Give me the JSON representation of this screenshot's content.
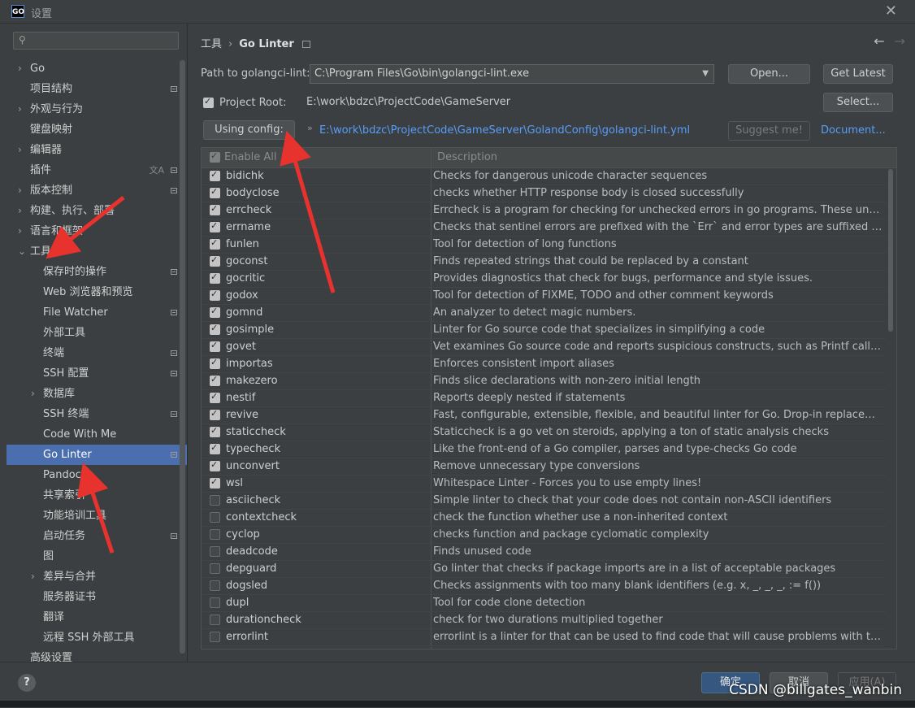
{
  "window": {
    "title": "设置",
    "app_icon_text": "GO"
  },
  "search": {
    "placeholder": ""
  },
  "sidebar": {
    "items": [
      {
        "label": "Go",
        "level": 0,
        "chevron": "›",
        "badge": false
      },
      {
        "label": "项目结构",
        "level": 0,
        "chevron": "",
        "badge": true
      },
      {
        "label": "外观与行为",
        "level": 0,
        "chevron": "›",
        "badge": false
      },
      {
        "label": "键盘映射",
        "level": 0,
        "chevron": "",
        "badge": false
      },
      {
        "label": "编辑器",
        "level": 0,
        "chevron": "›",
        "badge": false
      },
      {
        "label": "插件",
        "level": 0,
        "chevron": "",
        "badge": true,
        "translate": true
      },
      {
        "label": "版本控制",
        "level": 0,
        "chevron": "›",
        "badge": true
      },
      {
        "label": "构建、执行、部署",
        "level": 0,
        "chevron": "›",
        "badge": false
      },
      {
        "label": "语言和框架",
        "level": 0,
        "chevron": "›",
        "badge": false
      },
      {
        "label": "工具",
        "level": 0,
        "chevron": "⌄",
        "badge": false
      },
      {
        "label": "保存时的操作",
        "level": 1,
        "chevron": "",
        "badge": true
      },
      {
        "label": "Web 浏览器和预览",
        "level": 1,
        "chevron": "",
        "badge": false
      },
      {
        "label": "File Watcher",
        "level": 1,
        "chevron": "",
        "badge": true
      },
      {
        "label": "外部工具",
        "level": 1,
        "chevron": "",
        "badge": false
      },
      {
        "label": "终端",
        "level": 1,
        "chevron": "",
        "badge": true
      },
      {
        "label": "SSH 配置",
        "level": 1,
        "chevron": "",
        "badge": true
      },
      {
        "label": "数据库",
        "level": 1,
        "chevron": "›",
        "badge": false
      },
      {
        "label": "SSH 终端",
        "level": 1,
        "chevron": "",
        "badge": true
      },
      {
        "label": "Code With Me",
        "level": 1,
        "chevron": "",
        "badge": false
      },
      {
        "label": "Go Linter",
        "level": 1,
        "chevron": "",
        "badge": true,
        "selected": true
      },
      {
        "label": "Pandoc",
        "level": 1,
        "chevron": "",
        "badge": false
      },
      {
        "label": "共享索引",
        "level": 1,
        "chevron": "",
        "badge": false
      },
      {
        "label": "功能培训工具",
        "level": 1,
        "chevron": "",
        "badge": false
      },
      {
        "label": "启动任务",
        "level": 1,
        "chevron": "",
        "badge": true
      },
      {
        "label": "图",
        "level": 1,
        "chevron": "",
        "badge": false
      },
      {
        "label": "差异与合并",
        "level": 1,
        "chevron": "›",
        "badge": false
      },
      {
        "label": "服务器证书",
        "level": 1,
        "chevron": "",
        "badge": false
      },
      {
        "label": "翻译",
        "level": 1,
        "chevron": "",
        "badge": false
      },
      {
        "label": "远程 SSH 外部工具",
        "level": 1,
        "chevron": "",
        "badge": false
      },
      {
        "label": "高级设置",
        "level": 0,
        "chevron": "",
        "badge": false
      }
    ]
  },
  "breadcrumb": {
    "parent": "工具",
    "separator": "›",
    "current": "Go Linter"
  },
  "form": {
    "path_label": "Path to golangci-lint:",
    "path_value": "C:\\Program Files\\Go\\bin\\golangci-lint.exe",
    "open_button": "Open...",
    "get_latest_button": "Get Latest",
    "project_root_label": "Project Root:",
    "project_root_checked": true,
    "project_root_value": "E:\\work\\bdzc\\ProjectCode\\GameServer",
    "select_button": "Select...",
    "using_config_button": "Using config:",
    "config_arrow": "»",
    "config_path": "E:\\work\\bdzc\\ProjectCode\\GameServer\\GolandConfig\\golangci-lint.yml",
    "suggest_button": "Suggest me!",
    "document_link": "Document..."
  },
  "table": {
    "col_enable": "Enable All",
    "col_description": "Description",
    "rows": [
      {
        "name": "bidichk",
        "enabled": true,
        "desc": "Checks for dangerous unicode character sequences"
      },
      {
        "name": "bodyclose",
        "enabled": true,
        "desc": "checks whether HTTP response body is closed successfully"
      },
      {
        "name": "errcheck",
        "enabled": true,
        "desc": "Errcheck is a program for checking for unchecked errors in go programs. These unchecked errors"
      },
      {
        "name": "errname",
        "enabled": true,
        "desc": "Checks that sentinel errors are prefixed with the `Err` and error types are suffixed with the `Error`"
      },
      {
        "name": "funlen",
        "enabled": true,
        "desc": "Tool for detection of long functions"
      },
      {
        "name": "goconst",
        "enabled": true,
        "desc": "Finds repeated strings that could be replaced by a constant"
      },
      {
        "name": "gocritic",
        "enabled": true,
        "desc": "Provides diagnostics that check for bugs, performance and style issues."
      },
      {
        "name": "godox",
        "enabled": true,
        "desc": "Tool for detection of FIXME, TODO and other comment keywords"
      },
      {
        "name": "gomnd",
        "enabled": true,
        "desc": "An analyzer to detect magic numbers."
      },
      {
        "name": "gosimple",
        "enabled": true,
        "desc": "Linter for Go source code that specializes in simplifying a code"
      },
      {
        "name": "govet",
        "enabled": true,
        "desc": "Vet examines Go source code and reports suspicious constructs, such as Printf calls whose arguments"
      },
      {
        "name": "importas",
        "enabled": true,
        "desc": "Enforces consistent import aliases"
      },
      {
        "name": "makezero",
        "enabled": true,
        "desc": "Finds slice declarations with non-zero initial length"
      },
      {
        "name": "nestif",
        "enabled": true,
        "desc": "Reports deeply nested if statements"
      },
      {
        "name": "revive",
        "enabled": true,
        "desc": "Fast, configurable, extensible, flexible, and beautiful linter for Go. Drop-in replacement of golint."
      },
      {
        "name": "staticcheck",
        "enabled": true,
        "desc": "Staticcheck is a go vet on steroids, applying a ton of static analysis checks"
      },
      {
        "name": "typecheck",
        "enabled": true,
        "desc": "Like the front-end of a Go compiler, parses and type-checks Go code"
      },
      {
        "name": "unconvert",
        "enabled": true,
        "desc": "Remove unnecessary type conversions"
      },
      {
        "name": "wsl",
        "enabled": true,
        "desc": "Whitespace Linter - Forces you to use empty lines!"
      },
      {
        "name": "asciicheck",
        "enabled": false,
        "desc": "Simple linter to check that your code does not contain non-ASCII identifiers"
      },
      {
        "name": "contextcheck",
        "enabled": false,
        "desc": "check the function whether use a non-inherited context"
      },
      {
        "name": "cyclop",
        "enabled": false,
        "desc": "checks function and package cyclomatic complexity"
      },
      {
        "name": "deadcode",
        "enabled": false,
        "desc": "Finds unused code"
      },
      {
        "name": "depguard",
        "enabled": false,
        "desc": "Go linter that checks if package imports are in a list of acceptable packages"
      },
      {
        "name": "dogsled",
        "enabled": false,
        "desc": "Checks assignments with too many blank identifiers (e.g. x, _, _, _, := f())"
      },
      {
        "name": "dupl",
        "enabled": false,
        "desc": "Tool for code clone detection"
      },
      {
        "name": "durationcheck",
        "enabled": false,
        "desc": "check for two durations multiplied together"
      },
      {
        "name": "errorlint",
        "enabled": false,
        "desc": "errorlint is a linter for that can be used to find code that will cause problems with the error wrapping"
      }
    ]
  },
  "footer": {
    "help": "?",
    "ok": "确定",
    "cancel": "取消",
    "apply": "应用(A)",
    "watermark": "CSDN @billgates_wanbin"
  },
  "colors": {
    "selected": "#4b6eaf",
    "link": "#589df6",
    "arrow": "#e8322e",
    "ok": "#365880"
  }
}
